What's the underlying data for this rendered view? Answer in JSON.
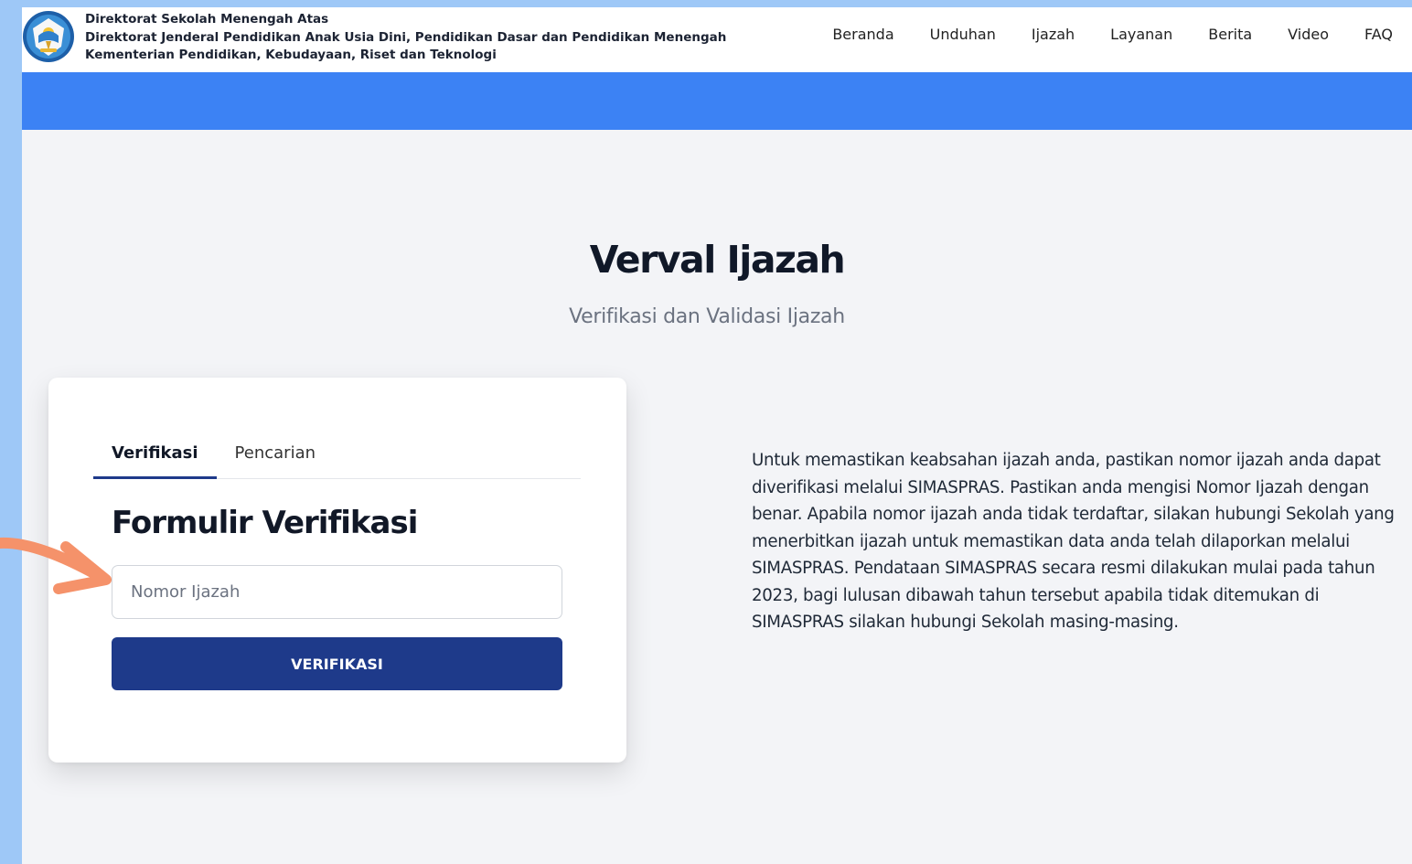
{
  "header": {
    "org_lines": [
      "Direktorat Sekolah Menengah Atas",
      "Direktorat Jenderal Pendidikan Anak Usia Dini, Pendidikan Dasar dan Pendidikan Menengah",
      "Kementerian Pendidikan, Kebudayaan, Riset dan Teknologi"
    ],
    "logo_icon": "tut-wuri-handayani-logo",
    "nav": [
      "Beranda",
      "Unduhan",
      "Ijazah",
      "Layanan",
      "Berita",
      "Video",
      "FAQ"
    ]
  },
  "hero": {
    "title": "Verval Ijazah",
    "subtitle": "Verifikasi dan Validasi Ijazah"
  },
  "card": {
    "tabs": [
      {
        "label": "Verifikasi",
        "active": true
      },
      {
        "label": "Pencarian",
        "active": false
      }
    ],
    "form_title": "Formulir Verifikasi",
    "input_placeholder": "Nomor Ijazah",
    "input_value": "",
    "button_label": "VERIFIKASI"
  },
  "info_text": "Untuk memastikan keabsahan ijazah anda, pastikan nomor ijazah anda dapat diverifikasi melalui SIMASPRAS. Pastikan anda mengisi Nomor Ijazah dengan benar. Apabila nomor ijazah anda tidak terdaftar, silakan hubungi Sekolah yang menerbitkan ijazah untuk memastikan data anda telah dilaporkan melalui SIMASPRAS. Pendataan SIMASPRAS secara resmi dilakukan mulai pada tahun 2023, bagi lulusan dibawah tahun tersebut apabila tidak ditemukan di SIMASPRAS silakan hubungi Sekolah masing-masing.",
  "colors": {
    "band": "#3c82f4",
    "button": "#1e3a8a",
    "annotation_arrow": "#f5926a",
    "outer_background": "#9ec8f7"
  },
  "annotation": {
    "icon": "pointer-arrow-icon"
  }
}
